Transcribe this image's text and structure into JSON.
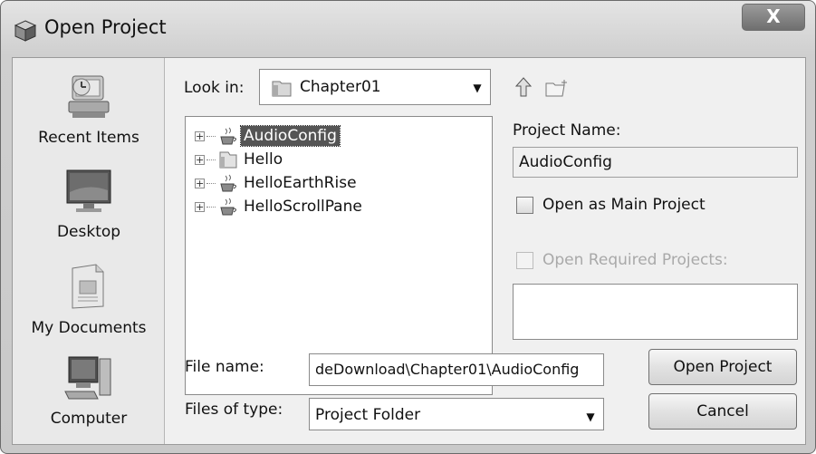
{
  "window": {
    "title": "Open Project",
    "close_label": "X"
  },
  "places": [
    {
      "label": "Recent Items",
      "icon": "recent-items-icon"
    },
    {
      "label": "Desktop",
      "icon": "desktop-icon"
    },
    {
      "label": "My Documents",
      "icon": "my-documents-icon"
    },
    {
      "label": "Computer",
      "icon": "computer-icon"
    }
  ],
  "look_in": {
    "label": "Look in:",
    "value": "Chapter01"
  },
  "tree": {
    "items": [
      {
        "label": "AudioConfig",
        "icon": "java-project-icon",
        "selected": true
      },
      {
        "label": "Hello",
        "icon": "folder-icon",
        "selected": false
      },
      {
        "label": "HelloEarthRise",
        "icon": "java-project-icon",
        "selected": false
      },
      {
        "label": "HelloScrollPane",
        "icon": "java-project-icon",
        "selected": false
      }
    ]
  },
  "project": {
    "name_label": "Project Name:",
    "name_value": "AudioConfig",
    "open_main_label": "Open as Main Project",
    "open_required_label": "Open Required Projects:"
  },
  "file": {
    "name_label": "File name:",
    "name_value": "deDownload\\Chapter01\\AudioConfig",
    "type_label": "Files of type:",
    "type_value": "Project Folder"
  },
  "buttons": {
    "open": "Open Project",
    "cancel": "Cancel"
  }
}
